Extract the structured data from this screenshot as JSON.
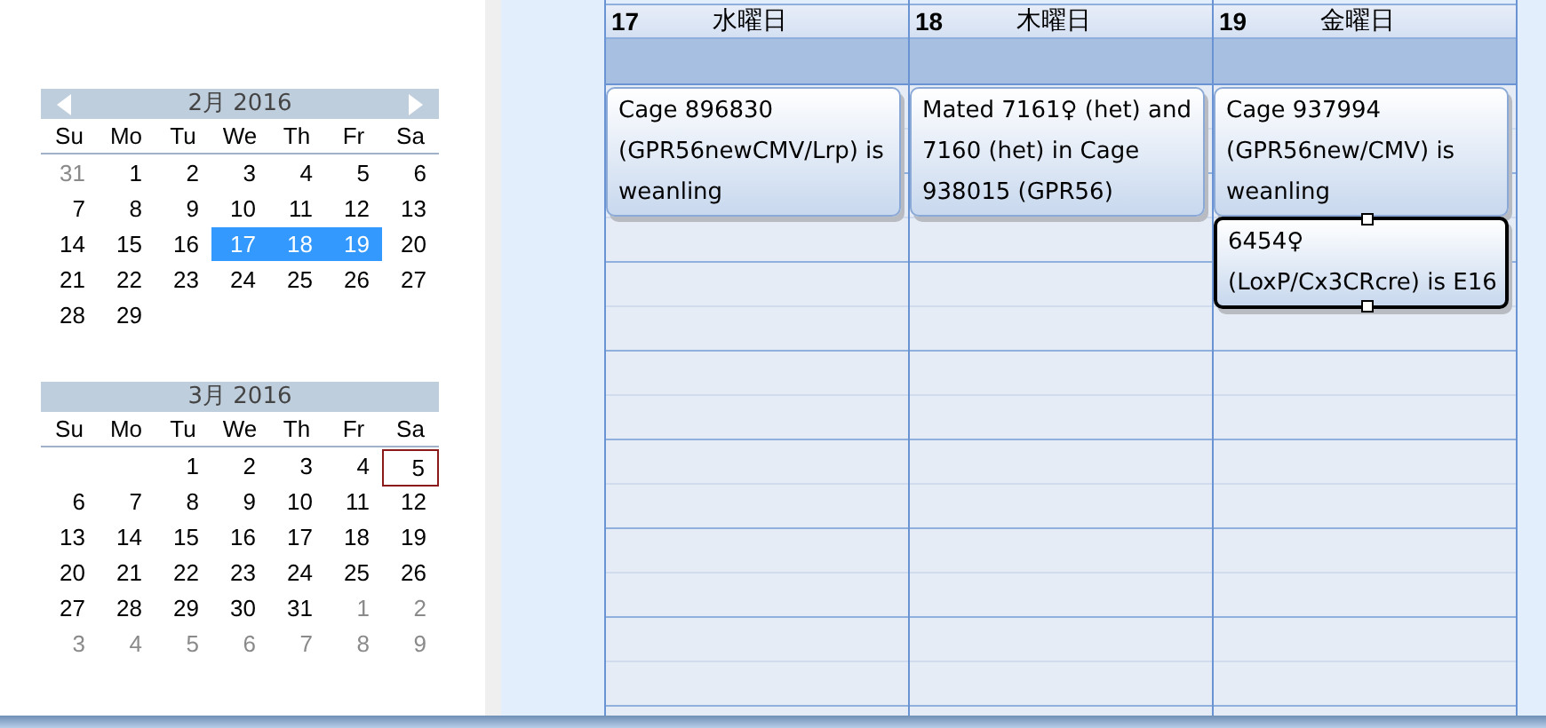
{
  "mini_calendars": [
    {
      "title": "2月 2016",
      "nav_arrows": true,
      "weekdays": [
        "Su",
        "Mo",
        "Tu",
        "We",
        "Th",
        "Fr",
        "Sa"
      ],
      "weeks": [
        [
          {
            "day": "31",
            "muted": true,
            "selected": false,
            "today": false
          },
          {
            "day": "1",
            "muted": false,
            "selected": false,
            "today": false
          },
          {
            "day": "2",
            "muted": false,
            "selected": false,
            "today": false
          },
          {
            "day": "3",
            "muted": false,
            "selected": false,
            "today": false
          },
          {
            "day": "4",
            "muted": false,
            "selected": false,
            "today": false
          },
          {
            "day": "5",
            "muted": false,
            "selected": false,
            "today": false
          },
          {
            "day": "6",
            "muted": false,
            "selected": false,
            "today": false
          }
        ],
        [
          {
            "day": "7",
            "muted": false,
            "selected": false,
            "today": false
          },
          {
            "day": "8",
            "muted": false,
            "selected": false,
            "today": false
          },
          {
            "day": "9",
            "muted": false,
            "selected": false,
            "today": false
          },
          {
            "day": "10",
            "muted": false,
            "selected": false,
            "today": false
          },
          {
            "day": "11",
            "muted": false,
            "selected": false,
            "today": false
          },
          {
            "day": "12",
            "muted": false,
            "selected": false,
            "today": false
          },
          {
            "day": "13",
            "muted": false,
            "selected": false,
            "today": false
          }
        ],
        [
          {
            "day": "14",
            "muted": false,
            "selected": false,
            "today": false
          },
          {
            "day": "15",
            "muted": false,
            "selected": false,
            "today": false
          },
          {
            "day": "16",
            "muted": false,
            "selected": false,
            "today": false
          },
          {
            "day": "17",
            "muted": false,
            "selected": true,
            "today": false
          },
          {
            "day": "18",
            "muted": false,
            "selected": true,
            "today": false
          },
          {
            "day": "19",
            "muted": false,
            "selected": true,
            "today": false
          },
          {
            "day": "20",
            "muted": false,
            "selected": false,
            "today": false
          }
        ],
        [
          {
            "day": "21",
            "muted": false,
            "selected": false,
            "today": false
          },
          {
            "day": "22",
            "muted": false,
            "selected": false,
            "today": false
          },
          {
            "day": "23",
            "muted": false,
            "selected": false,
            "today": false
          },
          {
            "day": "24",
            "muted": false,
            "selected": false,
            "today": false
          },
          {
            "day": "25",
            "muted": false,
            "selected": false,
            "today": false
          },
          {
            "day": "26",
            "muted": false,
            "selected": false,
            "today": false
          },
          {
            "day": "27",
            "muted": false,
            "selected": false,
            "today": false
          }
        ],
        [
          {
            "day": "28",
            "muted": false,
            "selected": false,
            "today": false
          },
          {
            "day": "29",
            "muted": false,
            "selected": false,
            "today": false
          }
        ]
      ]
    },
    {
      "title": "3月 2016",
      "nav_arrows": false,
      "weekdays": [
        "Su",
        "Mo",
        "Tu",
        "We",
        "Th",
        "Fr",
        "Sa"
      ],
      "weeks": [
        [
          {
            "day": "1",
            "muted": false,
            "selected": false,
            "today": false
          },
          {
            "day": "2",
            "muted": false,
            "selected": false,
            "today": false
          },
          {
            "day": "3",
            "muted": false,
            "selected": false,
            "today": false
          },
          {
            "day": "4",
            "muted": false,
            "selected": false,
            "today": false
          },
          {
            "day": "5",
            "muted": false,
            "selected": false,
            "today": true
          }
        ],
        [
          {
            "day": "6",
            "muted": false,
            "selected": false,
            "today": false
          },
          {
            "day": "7",
            "muted": false,
            "selected": false,
            "today": false
          },
          {
            "day": "8",
            "muted": false,
            "selected": false,
            "today": false
          },
          {
            "day": "9",
            "muted": false,
            "selected": false,
            "today": false
          },
          {
            "day": "10",
            "muted": false,
            "selected": false,
            "today": false
          },
          {
            "day": "11",
            "muted": false,
            "selected": false,
            "today": false
          },
          {
            "day": "12",
            "muted": false,
            "selected": false,
            "today": false
          }
        ],
        [
          {
            "day": "13",
            "muted": false,
            "selected": false,
            "today": false
          },
          {
            "day": "14",
            "muted": false,
            "selected": false,
            "today": false
          },
          {
            "day": "15",
            "muted": false,
            "selected": false,
            "today": false
          },
          {
            "day": "16",
            "muted": false,
            "selected": false,
            "today": false
          },
          {
            "day": "17",
            "muted": false,
            "selected": false,
            "today": false
          },
          {
            "day": "18",
            "muted": false,
            "selected": false,
            "today": false
          },
          {
            "day": "19",
            "muted": false,
            "selected": false,
            "today": false
          }
        ],
        [
          {
            "day": "20",
            "muted": false,
            "selected": false,
            "today": false
          },
          {
            "day": "21",
            "muted": false,
            "selected": false,
            "today": false
          },
          {
            "day": "22",
            "muted": false,
            "selected": false,
            "today": false
          },
          {
            "day": "23",
            "muted": false,
            "selected": false,
            "today": false
          },
          {
            "day": "24",
            "muted": false,
            "selected": false,
            "today": false
          },
          {
            "day": "25",
            "muted": false,
            "selected": false,
            "today": false
          },
          {
            "day": "26",
            "muted": false,
            "selected": false,
            "today": false
          }
        ],
        [
          {
            "day": "27",
            "muted": false,
            "selected": false,
            "today": false
          },
          {
            "day": "28",
            "muted": false,
            "selected": false,
            "today": false
          },
          {
            "day": "29",
            "muted": false,
            "selected": false,
            "today": false
          },
          {
            "day": "30",
            "muted": false,
            "selected": false,
            "today": false
          },
          {
            "day": "31",
            "muted": false,
            "selected": false,
            "today": false
          },
          {
            "day": "1",
            "muted": true,
            "selected": false,
            "today": false
          },
          {
            "day": "2",
            "muted": true,
            "selected": false,
            "today": false
          }
        ],
        [
          {
            "day": "3",
            "muted": true,
            "selected": false,
            "today": false
          },
          {
            "day": "4",
            "muted": true,
            "selected": false,
            "today": false
          },
          {
            "day": "5",
            "muted": true,
            "selected": false,
            "today": false
          },
          {
            "day": "6",
            "muted": true,
            "selected": false,
            "today": false
          },
          {
            "day": "7",
            "muted": true,
            "selected": false,
            "today": false
          },
          {
            "day": "8",
            "muted": true,
            "selected": false,
            "today": false
          },
          {
            "day": "9",
            "muted": true,
            "selected": false,
            "today": false
          }
        ]
      ]
    }
  ],
  "day_columns": [
    {
      "date": "17",
      "weekday": "水曜日",
      "events": [
        {
          "text": "Cage 896830 (GPR56newCMV/Lrp) is weanling",
          "selected": false
        }
      ]
    },
    {
      "date": "18",
      "weekday": "木曜日",
      "events": [
        {
          "text": "Mated 7161♀ (het) and 7160 (het) in Cage 938015 (GPR56)",
          "selected": false
        }
      ]
    },
    {
      "date": "19",
      "weekday": "金曜日",
      "events": [
        {
          "text": "Cage 937994 (GPR56new/CMV) is weanling",
          "selected": false
        },
        {
          "text": "6454♀ (LoxP/Cx3CRcre) is E16",
          "selected": true
        }
      ]
    }
  ]
}
